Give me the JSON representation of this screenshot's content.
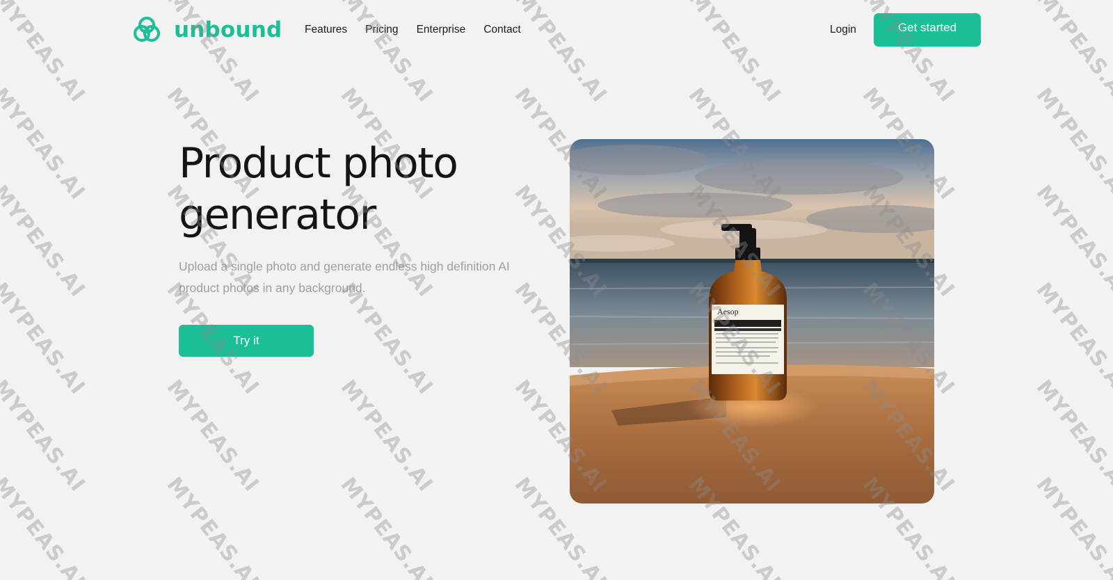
{
  "brand": {
    "name": "unbound",
    "accent_color": "#1bbf97",
    "logo_icon": "trefoil-knot-icon"
  },
  "nav": {
    "items": [
      {
        "label": "Features"
      },
      {
        "label": "Pricing"
      },
      {
        "label": "Enterprise"
      },
      {
        "label": "Contact"
      }
    ],
    "login_label": "Login",
    "cta_label": "Get started"
  },
  "hero": {
    "title": "Product photo generator",
    "subtitle": "Upload a single photo and generate endless high definition AI product photos in any background.",
    "button_label": "Try it"
  },
  "product_photo": {
    "bottle_brand": "Aesop",
    "label_lines": [
      "Resurrection Aromatique Hand Wash",
      "Gel Lavant Résurrection Aromatique pour les Mains"
    ],
    "volume": "500 mL"
  },
  "watermark": {
    "text": "MYPEAS.AI"
  }
}
